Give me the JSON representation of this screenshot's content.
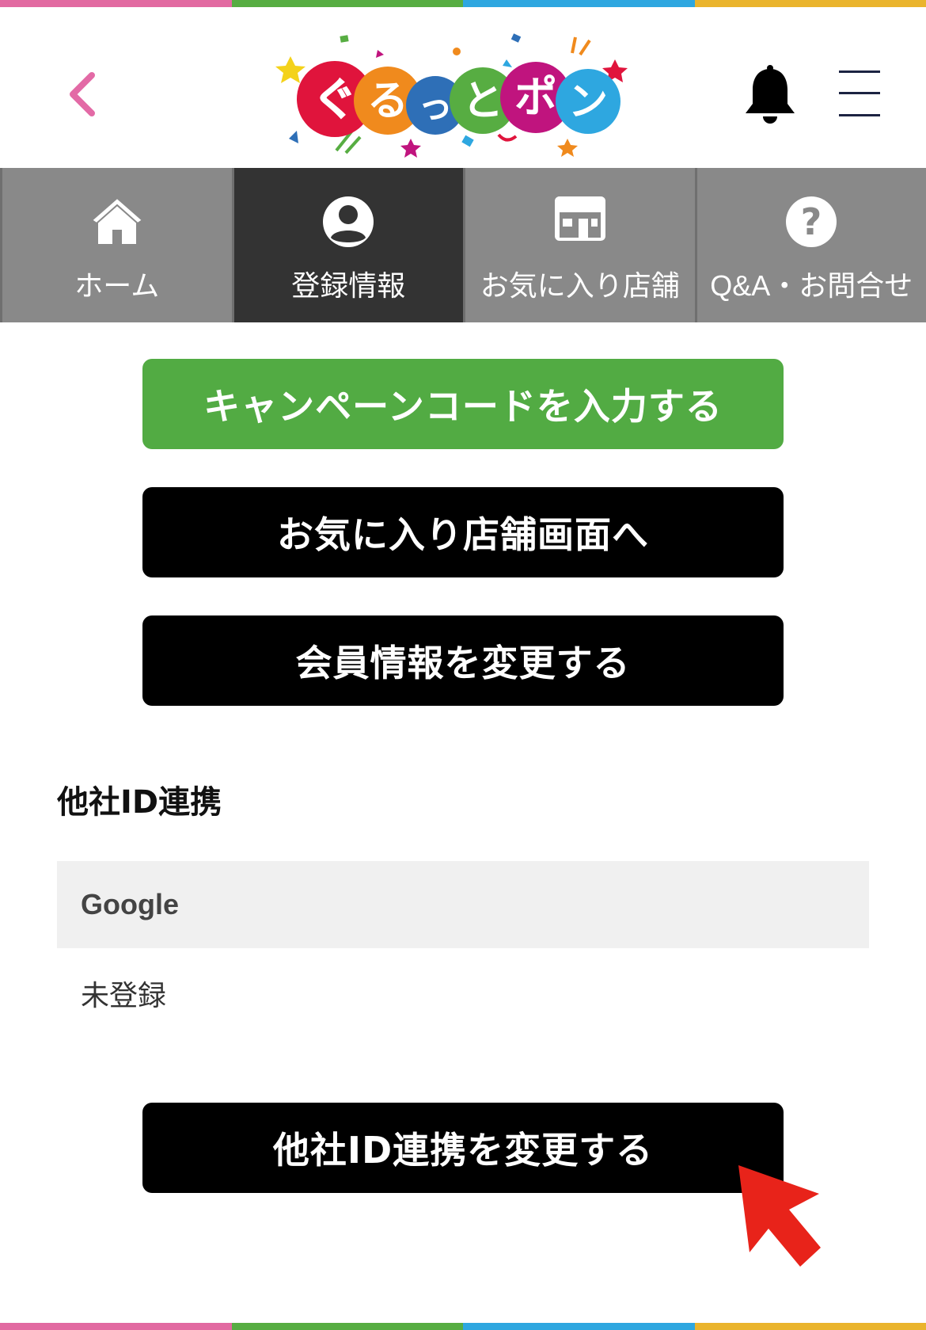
{
  "colors": {
    "stripe": [
      "#e26aa1",
      "#57ad42",
      "#2ea7e0",
      "#eab42d"
    ],
    "back_arrow": "#e36aa6",
    "nav_bg": "#898989",
    "nav_active_bg": "#333333",
    "green_button": "#52ab43",
    "black_button": "#000000",
    "pointer": "#e8231a"
  },
  "header": {
    "logo_text": "ぐるっとポン",
    "back_icon": "chevron-left-icon",
    "bell_icon": "bell-icon",
    "menu_icon": "hamburger-menu-icon"
  },
  "nav": {
    "tabs": [
      {
        "label": "ホーム",
        "icon": "home-icon",
        "active": false
      },
      {
        "label": "登録情報",
        "icon": "user-circle-icon",
        "active": true
      },
      {
        "label": "お気に入り店舗",
        "icon": "store-icon",
        "active": false
      },
      {
        "label": "Q&A・お問合せ",
        "icon": "question-circle-icon",
        "active": false
      }
    ]
  },
  "buttons": {
    "campaign_code": "キャンペーンコードを入力する",
    "favorite_stores": "お気に入り店舗画面へ",
    "edit_member_info": "会員情報を変更する",
    "edit_linked_ids": "他社ID連携を変更する"
  },
  "linked_ids": {
    "title": "他社ID連携",
    "provider": "Google",
    "status": "未登録"
  }
}
